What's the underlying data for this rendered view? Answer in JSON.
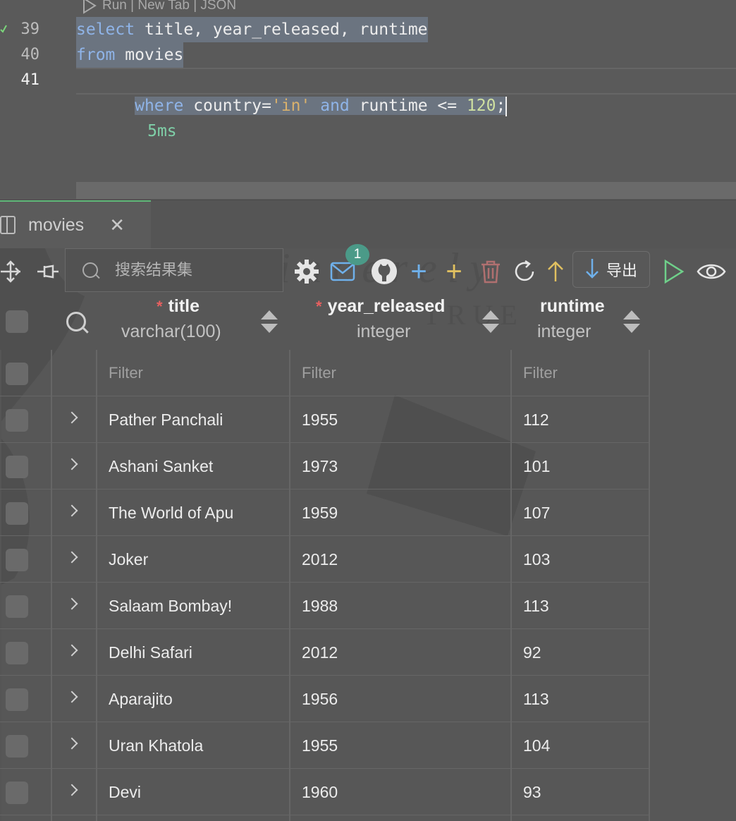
{
  "editor": {
    "codelens": "Run | New Tab | JSON",
    "lines": [
      {
        "number": "39",
        "tokens": [
          {
            "t": "select",
            "c": "kw"
          },
          {
            "t": " title, year_released, runtime",
            "c": "plain"
          }
        ]
      },
      {
        "number": "40",
        "tokens": [
          {
            "t": "from",
            "c": "kw"
          },
          {
            "t": " movies",
            "c": "plain"
          }
        ]
      },
      {
        "number": "41",
        "tokens": [
          {
            "t": "where",
            "c": "kw"
          },
          {
            "t": " country=",
            "c": "plain"
          },
          {
            "t": "'in'",
            "c": "str"
          },
          {
            "t": " ",
            "c": "plain"
          },
          {
            "t": "and",
            "c": "kw"
          },
          {
            "t": " runtime <= ",
            "c": "plain"
          },
          {
            "t": "120",
            "c": "num"
          },
          {
            "t": ";",
            "c": "plain"
          }
        ]
      }
    ],
    "timing": "5ms"
  },
  "result_tab": {
    "label": "movies",
    "close_icon": "close-icon"
  },
  "toolbar": {
    "search_placeholder": "搜索结果集",
    "badge_count": "1",
    "export_label": "导出",
    "icons": [
      "move-icon",
      "pin-icon",
      "search-icon",
      "gear-icon",
      "mail-icon",
      "github-icon",
      "add-row-icon",
      "add-column-icon",
      "delete-icon",
      "refresh-icon",
      "upload-icon",
      "download-icon",
      "run-icon",
      "eye-icon"
    ]
  },
  "columns": [
    {
      "name": "title",
      "type": "varchar(100)",
      "required": "*"
    },
    {
      "name": "year_released",
      "type": "integer",
      "required": "*"
    },
    {
      "name": "runtime",
      "type": "integer",
      "required": ""
    }
  ],
  "filter_placeholder": "Filter",
  "rows": [
    {
      "title": "Pather Panchali",
      "year_released": "1955",
      "runtime": "112"
    },
    {
      "title": "Ashani Sanket",
      "year_released": "1973",
      "runtime": "101"
    },
    {
      "title": "The World of Apu",
      "year_released": "1959",
      "runtime": "107"
    },
    {
      "title": "Joker",
      "year_released": "2012",
      "runtime": "103"
    },
    {
      "title": "Salaam Bombay!",
      "year_released": "1988",
      "runtime": "113"
    },
    {
      "title": "Delhi Safari",
      "year_released": "2012",
      "runtime": "92"
    },
    {
      "title": "Aparajito",
      "year_released": "1956",
      "runtime": "113"
    },
    {
      "title": "Uran Khatola",
      "year_released": "1955",
      "runtime": "104"
    },
    {
      "title": "Devi",
      "year_released": "1960",
      "runtime": "93"
    }
  ],
  "colors": {
    "keyword": "#8fb4e8",
    "string": "#d9b16c",
    "number": "#cfe0a0",
    "timing": "#7fd0a8",
    "accent_green": "#5fb878",
    "badge": "#4b9a88",
    "required_marker": "#e86060"
  }
}
